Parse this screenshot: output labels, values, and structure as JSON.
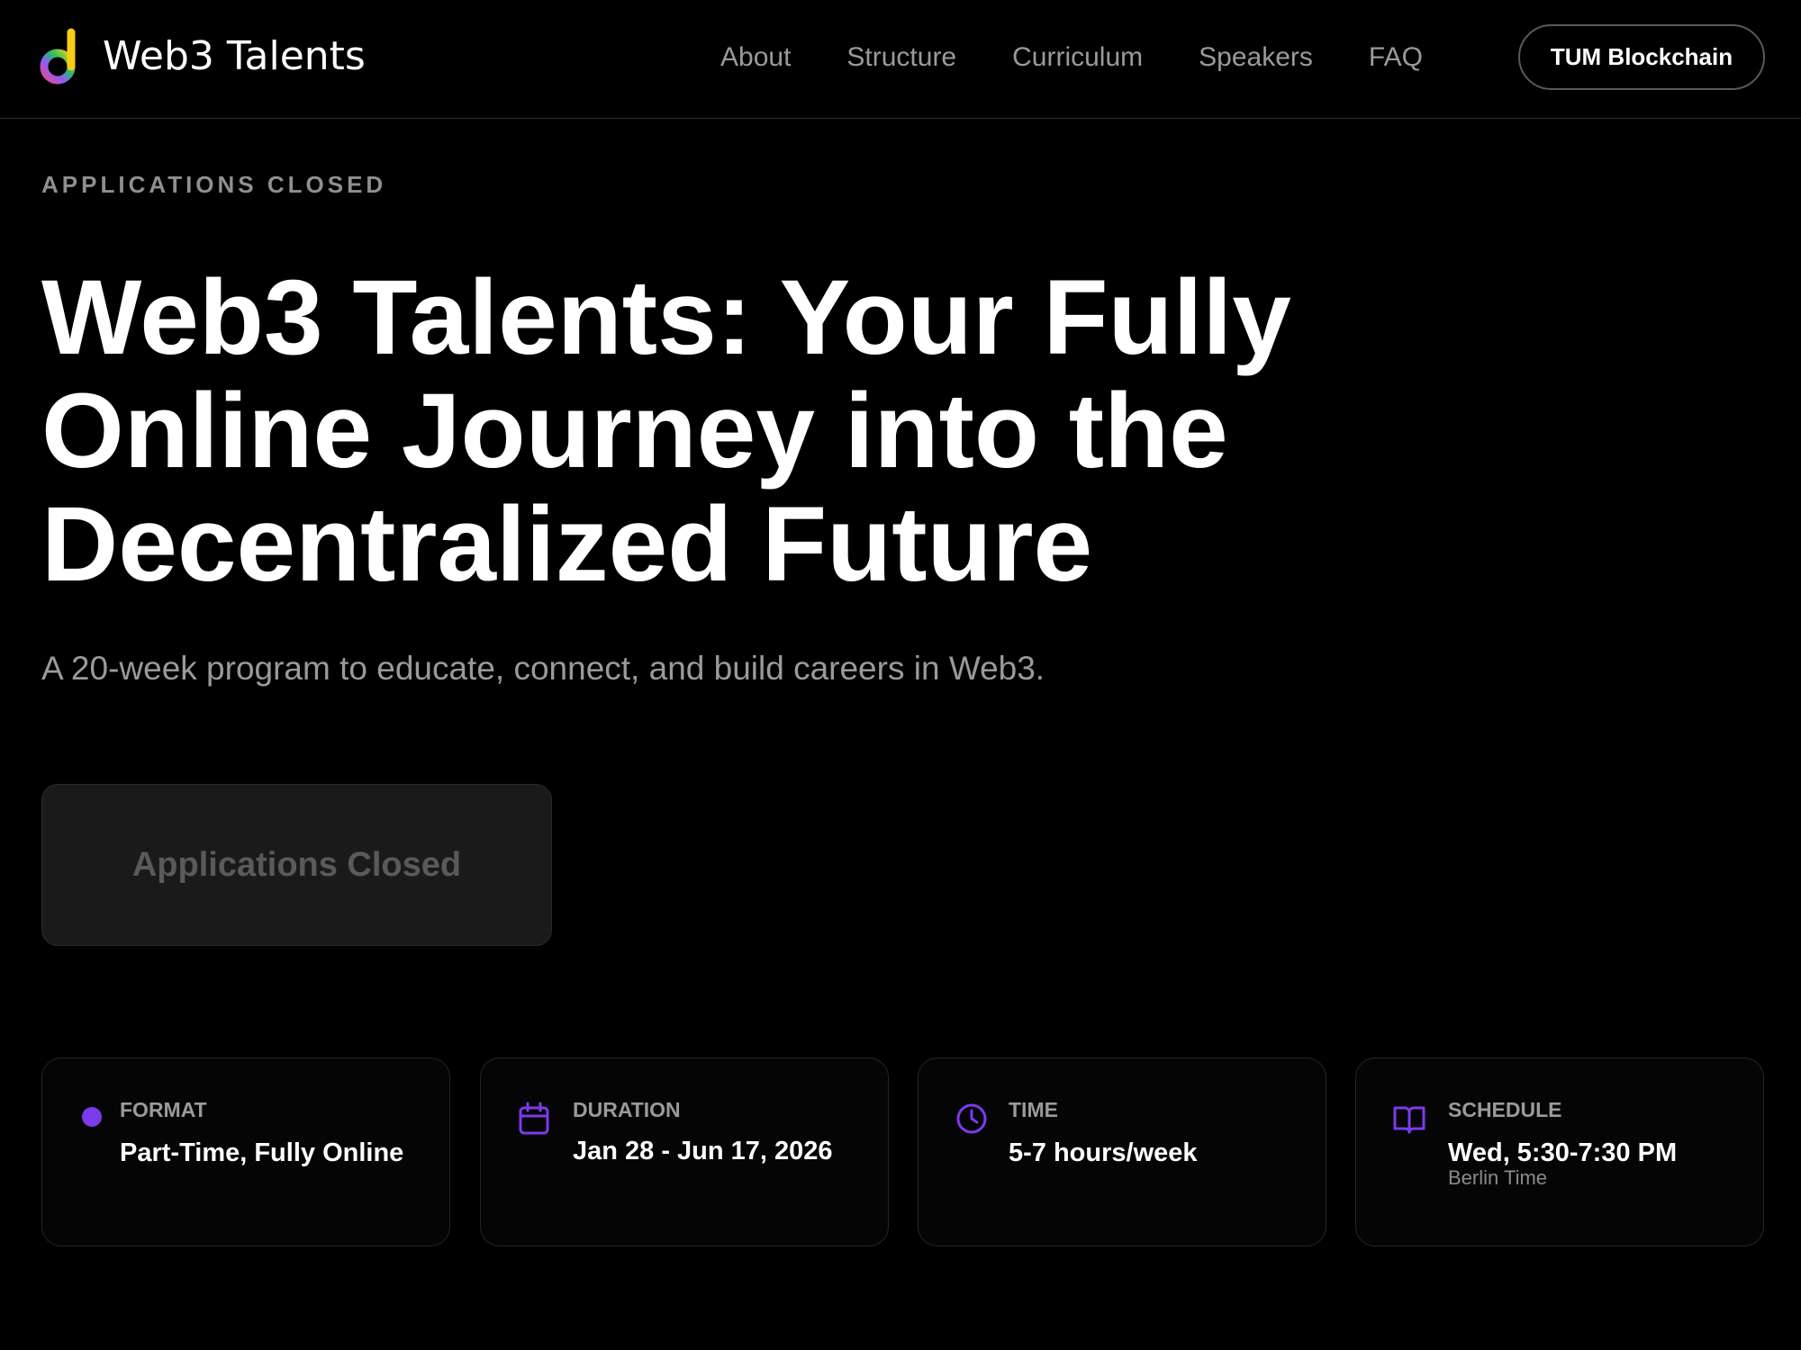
{
  "header": {
    "brand": "Web3 Talents",
    "nav": [
      "About",
      "Structure",
      "Curriculum",
      "Speakers",
      "FAQ"
    ],
    "cta_label": "TUM Blockchain"
  },
  "hero": {
    "eyebrow": "APPLICATIONS CLOSED",
    "title": "Web3 Talents: Your Fully Online Journey into the Decentralized Future",
    "subtitle": "A 20-week program to educate, connect, and build careers in Web3.",
    "button_label": "Applications Closed"
  },
  "cards": [
    {
      "icon": "dot-icon",
      "label": "FORMAT",
      "value": "Part-Time, Fully Online",
      "note": ""
    },
    {
      "icon": "calendar-icon",
      "label": "DURATION",
      "value": "Jan 28 - Jun 17, 2026",
      "note": ""
    },
    {
      "icon": "clock-icon",
      "label": "TIME",
      "value": "5-7 hours/week",
      "note": ""
    },
    {
      "icon": "book-icon",
      "label": "SCHEDULE",
      "value": "Wed, 5:30-7:30 PM",
      "note": "Berlin Time"
    }
  ],
  "colors": {
    "background": "#000000",
    "accent": "#7c3aed",
    "muted_text": "#9a9a9a",
    "card_border": "#262626"
  }
}
